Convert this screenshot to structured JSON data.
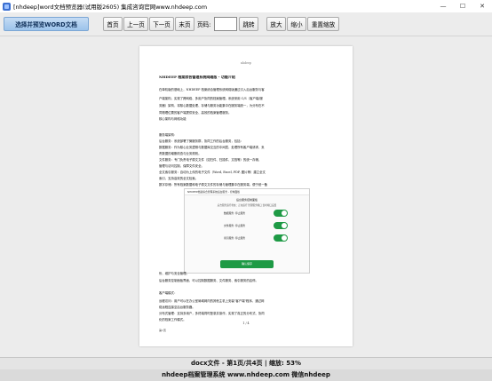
{
  "window": {
    "title": "[nhdeep]word文档预览器(试用版2605) 集成咨询官网www.nhdeep.com",
    "controls": [
      "—",
      "☐",
      "✕"
    ]
  },
  "toolbar": {
    "open_label": "选择并预览WORD文档",
    "first_label": "首页",
    "prev_label": "上一页",
    "next_label": "下一页",
    "last_label": "末页",
    "page_label": "页码:",
    "page_value": "",
    "jump_label": "跳转",
    "zoom_in_label": "放大",
    "zoom_out_label": "缩小",
    "reset_zoom_label": "重置缩放"
  },
  "document": {
    "header": "nhdeep",
    "title": "NHDEEP 档案综合管理系统网络版 - 功能介绍",
    "lines": [
      "在单机版的基础上，NHDEEP 档案综合管理系统网络版通过引入后台服务与客",
      "户端架构，实现了跨网络、多用户协同的档案管理。系统采用 C/S（客户端/服",
      "务器）架构，将核心数据处理、存储与服务功能集中在服务端统一，为分布在不",
      "同物理位置的客户端提供安全、高效的档案管理服务。",
      "核心架构与网络功能",
      "服务端架构:",
      "后台服务：系统部署了微服务群，协同工作的后台服务，包括：",
      "数据服务：作为核心业务逻辑与数据库交互的中间层，处理所有客户端请求，负",
      "责数据的增删改查与业务规则。",
      "文件服务：专门负责电子原文文件（如扫件、扫描件、文档等）的统一存储、",
      "管理与访问控制，保障文件安全。",
      "全文索引服务：自动为上传的电子文件（Word, Excel, PDF, 图片等）建立全文",
      "索引，支持高效的全文检索。",
      "数字存储：所有档案数据和电子原文文件的存储与管理集中在服务端，便于统一备",
      "份、维护与安全管理。",
      "后台服务控制面板界面，可以控制数据服务、文件服务、索引服务的启停。",
      "客户端模式：",
      "远程访问：用户可以在办公室局域网内的其他主机上安装\"客户端\"程序，通过网",
      "络远程连接至后台服务器。",
      "分布式管理：支持多用户，多终端同时登录并操作，实现了真正的分布式、协同",
      "化的档案工作模式。"
    ],
    "footer": "1 / 4",
    "corner_note": "第1页"
  },
  "embedded_screenshot": {
    "titlebar": "NHDEEP档案综合管理系统后台服务 - 控制面板",
    "heading": "后台服务控制面板",
    "sub": "后台服务运行状态：正在运行  管理服务端口  监听端口设置",
    "services": [
      "数据服务: 停止服务",
      "文件服务: 停止服务",
      "索引服务: 停止服务"
    ],
    "button": "确认保存",
    "accent": "#1e9a45"
  },
  "status": {
    "text": "docx文件 - 第1页/共4页 | 缩放: 53%"
  },
  "footer": {
    "text": "nhdeep档案管理系统 www.nhdeep.com 微信nhdeep"
  },
  "colors": {
    "primary_button": "#9cc3eb",
    "viewer_bg": "#ececec",
    "toggle": "#1e9a45"
  }
}
